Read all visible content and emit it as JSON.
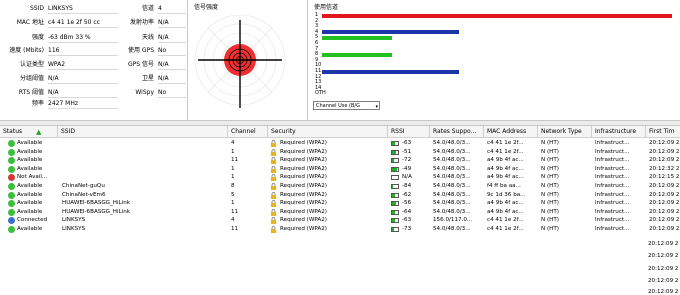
{
  "info": {
    "rows": [
      {
        "key": "SSID",
        "value": "LINKSYS"
      },
      {
        "key": "MAC 地址",
        "value": "c4 41 1e 2f 50 cc"
      },
      {
        "key": "强度",
        "value": "-63 dBm      33 %"
      },
      {
        "key": "速度 (Mbits)",
        "value": "116"
      },
      {
        "key": "认证类型",
        "value": "WPA2"
      },
      {
        "key": "分组阈值",
        "value": "N/A"
      },
      {
        "key": "RTS 阈值",
        "value": "N/A"
      },
      {
        "key": "频率",
        "value": "2427 MHz"
      }
    ],
    "rows2": [
      {
        "key": "信道",
        "value": "4"
      },
      {
        "key": "发射功率",
        "value": "N/A"
      },
      {
        "key": "天线",
        "value": "N/A"
      },
      {
        "key": "使用 GPS",
        "value": "No"
      },
      {
        "key": "GPS 信号",
        "value": "N/A"
      },
      {
        "key": "卫星",
        "value": "N/A"
      },
      {
        "key": "WiSpy",
        "value": "No"
      }
    ]
  },
  "signal_panel": {
    "title": "信号强度"
  },
  "channel_panel": {
    "title": "使用信道",
    "channel_labels": [
      "1",
      "2",
      "3",
      "4",
      "5",
      "6",
      "7",
      "8",
      "9",
      "10",
      "11",
      "12",
      "13",
      "14",
      "OTH"
    ],
    "select_value": "Channel Use (B/G"
  },
  "channel_usage": [
    {
      "channel": 1,
      "fraction": 1.0,
      "color": "#e3141b"
    },
    {
      "channel": 4,
      "fraction": 0.39,
      "color": "#1e35a8"
    },
    {
      "channel": 5,
      "fraction": 0.2,
      "color": "#22c022"
    },
    {
      "channel": 8,
      "fraction": 0.2,
      "color": "#22c022"
    },
    {
      "channel": 11,
      "fraction": 0.39,
      "color": "#1e35a8"
    }
  ],
  "table": {
    "columns": [
      "Status",
      "SSID",
      "Channel",
      "Security",
      "RSSI",
      "Rates Suppo...",
      "MAC Address",
      "Network Type",
      "Infrastructure",
      "First Tim"
    ],
    "rows": [
      {
        "status": "Available",
        "ssid": "",
        "channel": "4",
        "security": "Required (WPA2)",
        "rssi": "-63",
        "rates": "54.0/48.0/3...",
        "mac": "c4 41 1e 2f...",
        "nettype": "N (HT)",
        "infra": "Infrastruct...",
        "first": "20:12:09 2",
        "dot": "#3cbf3c",
        "signal": 0.5
      },
      {
        "status": "Available",
        "ssid": "",
        "channel": "1",
        "security": "Required (WPA2)",
        "rssi": "-51",
        "rates": "54.0/48.0/3...",
        "mac": "c4 41 1e 2f...",
        "nettype": "N (HT)",
        "infra": "Infrastruct...",
        "first": "20:12:09 2",
        "dot": "#3cbf3c",
        "signal": 0.7
      },
      {
        "status": "Available",
        "ssid": "",
        "channel": "11",
        "security": "Required (WPA2)",
        "rssi": "-72",
        "rates": "54.0/48.0/3...",
        "mac": "a4 9b 4f ac...",
        "nettype": "N (HT)",
        "infra": "Infrastruct...",
        "first": "20:12:09 2",
        "dot": "#3cbf3c",
        "signal": 0.4
      },
      {
        "status": "Available",
        "ssid": "",
        "channel": "1",
        "security": "Required (WPA2)",
        "rssi": "-49",
        "rates": "54.0/48.0/3...",
        "mac": "a4 9b 4f ac...",
        "nettype": "N (HT)",
        "infra": "Infrastruct...",
        "first": "20:12:32 2",
        "dot": "#3cbf3c",
        "signal": 0.8
      },
      {
        "status": "Not Avail...",
        "ssid": "",
        "channel": "1",
        "security": "Required (WPA2)",
        "rssi": "N/A",
        "rates": "54.0/48.0/3...",
        "mac": "a4 9b 4f ac...",
        "nettype": "N (HT)",
        "infra": "Infrastruct...",
        "first": "20:12:15 2",
        "dot": "#d13a3a",
        "signal": 0
      },
      {
        "status": "Available",
        "ssid": "ChinaNet-guQu",
        "channel": "8",
        "security": "Required (WPA2)",
        "rssi": "-84",
        "rates": "54.0/48.0/3...",
        "mac": "f4 ff ba aa...",
        "nettype": "N (HT)",
        "infra": "Infrastruct...",
        "first": "20:12:09 2",
        "dot": "#3cbf3c",
        "signal": 0.2
      },
      {
        "status": "Available",
        "ssid": "ChinaNet-vEm6",
        "channel": "5",
        "security": "Required (WPA2)",
        "rssi": "-62",
        "rates": "54.0/48.0/3...",
        "mac": "9c 1d 36 ba...",
        "nettype": "N (HT)",
        "infra": "Infrastruct...",
        "first": "20:12:09 2",
        "dot": "#3cbf3c",
        "signal": 0.5
      },
      {
        "status": "Available",
        "ssid": "HUAWEI-6BASGG_HiLink",
        "channel": "1",
        "security": "Required (WPA2)",
        "rssi": "-56",
        "rates": "54.0/48.0/3...",
        "mac": "a4 9b 4f ac...",
        "nettype": "N (HT)",
        "infra": "Infrastruct...",
        "first": "20:12:09 2",
        "dot": "#3cbf3c",
        "signal": 0.6
      },
      {
        "status": "Available",
        "ssid": "HUAWEI-6BASGG_HiLink",
        "channel": "11",
        "security": "Required (WPA2)",
        "rssi": "-64",
        "rates": "54.0/48.0/3...",
        "mac": "a4 9b 4f ac...",
        "nettype": "N (HT)",
        "infra": "Infrastruct...",
        "first": "20:12:09 2",
        "dot": "#3cbf3c",
        "signal": 0.5
      },
      {
        "status": "Connected",
        "ssid": "LINKSYS",
        "channel": "4",
        "security": "Required (WPA2)",
        "rssi": "-63",
        "rates": "156.0/117.0...",
        "mac": "c4 41 1e 2f...",
        "nettype": "N (HT)",
        "infra": "Infrastruct...",
        "first": "20:12:09 2",
        "dot": "#3a6fd1",
        "signal": 0.5
      },
      {
        "status": "Available",
        "ssid": "LINKSYS",
        "channel": "11",
        "security": "Required (WPA2)",
        "rssi": "-73",
        "rates": "54.0/48.0/3...",
        "mac": "c4 41 1e 2f...",
        "nettype": "N (HT)",
        "infra": "Infrastruct...",
        "first": "20:12:09 2",
        "dot": "#3cbf3c",
        "signal": 0.4
      }
    ],
    "extra_times": [
      "20:12:09 2",
      "20:12:09 2",
      "20:12:09 2",
      "20:12:09 2",
      "20:12:09 2"
    ]
  }
}
